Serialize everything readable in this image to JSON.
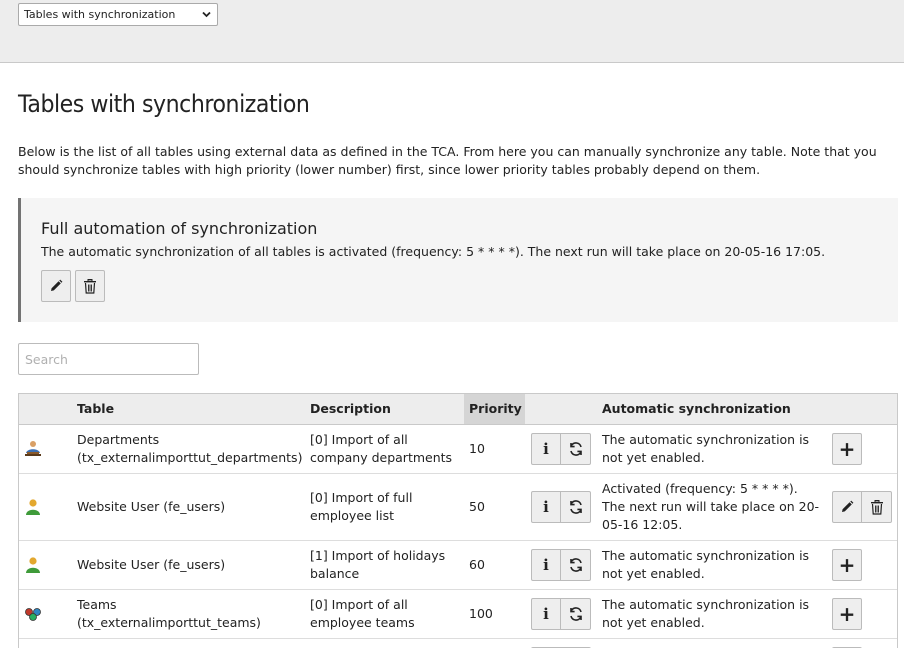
{
  "topbar": {
    "select_value": "Tables with synchronization"
  },
  "page": {
    "title": "Tables with synchronization",
    "intro": "Below is the list of all tables using external data as defined in the TCA. From here you can manually synchronize any table. Note that you should synchronize tables with high priority (lower number) first, since lower priority tables probably depend on them."
  },
  "automation": {
    "title": "Full automation of synchronization",
    "text": "The automatic synchronization of all tables is activated (frequency: 5 * * * *). The next run will take place on 20-05-16 17:05."
  },
  "search": {
    "placeholder": "Search",
    "value": ""
  },
  "table": {
    "columns": {
      "table": "Table",
      "description": "Description",
      "priority": "Priority",
      "automatic": "Automatic synchronization"
    },
    "rows": [
      {
        "icon": "departments-icon",
        "table_line1": "Departments",
        "table_line2": "(tx_externalimporttut_departments)",
        "desc_line1": "[0] Import of all",
        "desc_line2": "company departments",
        "priority": "10",
        "auto_line1": "The automatic synchronization is",
        "auto_line2": "not yet enabled.",
        "auto_line3": ""
      },
      {
        "icon": "user-icon",
        "table_line1": "Website User (fe_users)",
        "table_line2": "",
        "desc_line1": "[0] Import of full",
        "desc_line2": "employee list",
        "priority": "50",
        "auto_line1": "Activated (frequency: 5 * * * *).",
        "auto_line2": "The next run will take place on 20-",
        "auto_line3": "05-16 12:05."
      },
      {
        "icon": "user-icon",
        "table_line1": "Website User (fe_users)",
        "table_line2": "",
        "desc_line1": "[1] Import of holidays",
        "desc_line2": "balance",
        "priority": "60",
        "auto_line1": "The automatic synchronization is",
        "auto_line2": "not yet enabled.",
        "auto_line3": ""
      },
      {
        "icon": "teams-icon",
        "table_line1": "Teams",
        "table_line2": "(tx_externalimporttut_teams)",
        "desc_line1": "[0] Import of all",
        "desc_line2": "employee teams",
        "priority": "100",
        "auto_line1": "The automatic synchronization is",
        "auto_line2": "not yet enabled.",
        "auto_line3": ""
      }
    ]
  },
  "buttons": {
    "plus_symbol": "+",
    "info_symbol": "i"
  }
}
